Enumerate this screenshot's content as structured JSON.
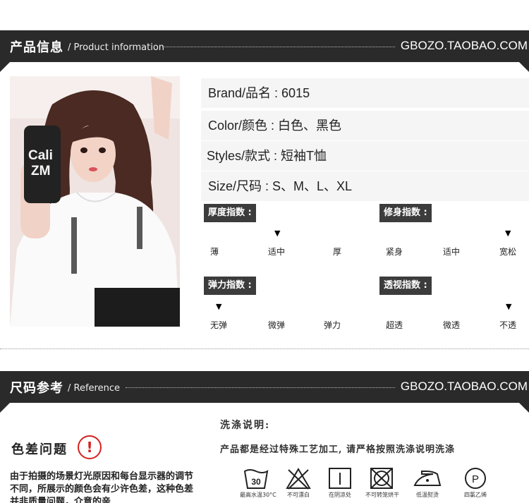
{
  "header1": {
    "title_zh": "产品信息",
    "title_en": "/ Product information",
    "shop": "GBOZO.TAOBAO.COM"
  },
  "header2": {
    "title_zh": "尺码参考",
    "title_en": "/ Reference",
    "shop": "GBOZO.TAOBAO.COM"
  },
  "photo": {
    "phone_text_1": "Cali",
    "phone_text_2": "ZM"
  },
  "specs": [
    {
      "key": "Brand/品名 : ",
      "value": "6015"
    },
    {
      "key": "Color/颜色 : ",
      "value": "白色、黑色"
    },
    {
      "key": "Styles/款式 : ",
      "value": "短袖T恤"
    },
    {
      "key": "Size/尺码 : ",
      "value": "S、M、L、XL"
    }
  ],
  "indices": [
    {
      "label": "厚度指数 :",
      "levels": [
        "薄",
        "适中",
        "厚"
      ],
      "selected": 1
    },
    {
      "label": "修身指数 :",
      "levels": [
        "紧身",
        "适中",
        "宽松"
      ],
      "selected": 2
    },
    {
      "label": "弹力指数 :",
      "levels": [
        "无弹",
        "微弹",
        "弹力"
      ],
      "selected": 0
    },
    {
      "label": "透视指数 :",
      "levels": [
        "超透",
        "微透",
        "不透"
      ],
      "selected": 2
    }
  ],
  "arrow_glyph": "▼",
  "color_notice": {
    "title": "色差问题",
    "icon": "!",
    "text": "由于拍摄的场景灯光原因和每台显示器的调节不同，所展示的颜色会有少许色差，这种色差并非质量问题，介意的亲"
  },
  "wash": {
    "title": "洗涤说明:",
    "desc": "产品都是经过特殊工艺加工, 请严格按照洗涤说明洗涤",
    "icons": [
      {
        "name": "wash-30-icon",
        "label": "最高水温30°C",
        "number": "30"
      },
      {
        "name": "no-bleach-icon",
        "label": "不可漂白"
      },
      {
        "name": "line-dry-icon",
        "label": "在阴凉处"
      },
      {
        "name": "no-tumble-dry-icon",
        "label": "不可转笼烘干"
      },
      {
        "name": "low-iron-icon",
        "label": "低温熨烫"
      },
      {
        "name": "dry-clean-p-icon",
        "label": "四氯乙烯",
        "letter": "P"
      }
    ]
  },
  "colors": {
    "band": "#2a2a2a",
    "spec_bg": "#f5f5f5",
    "warn_red": "#d52020"
  }
}
